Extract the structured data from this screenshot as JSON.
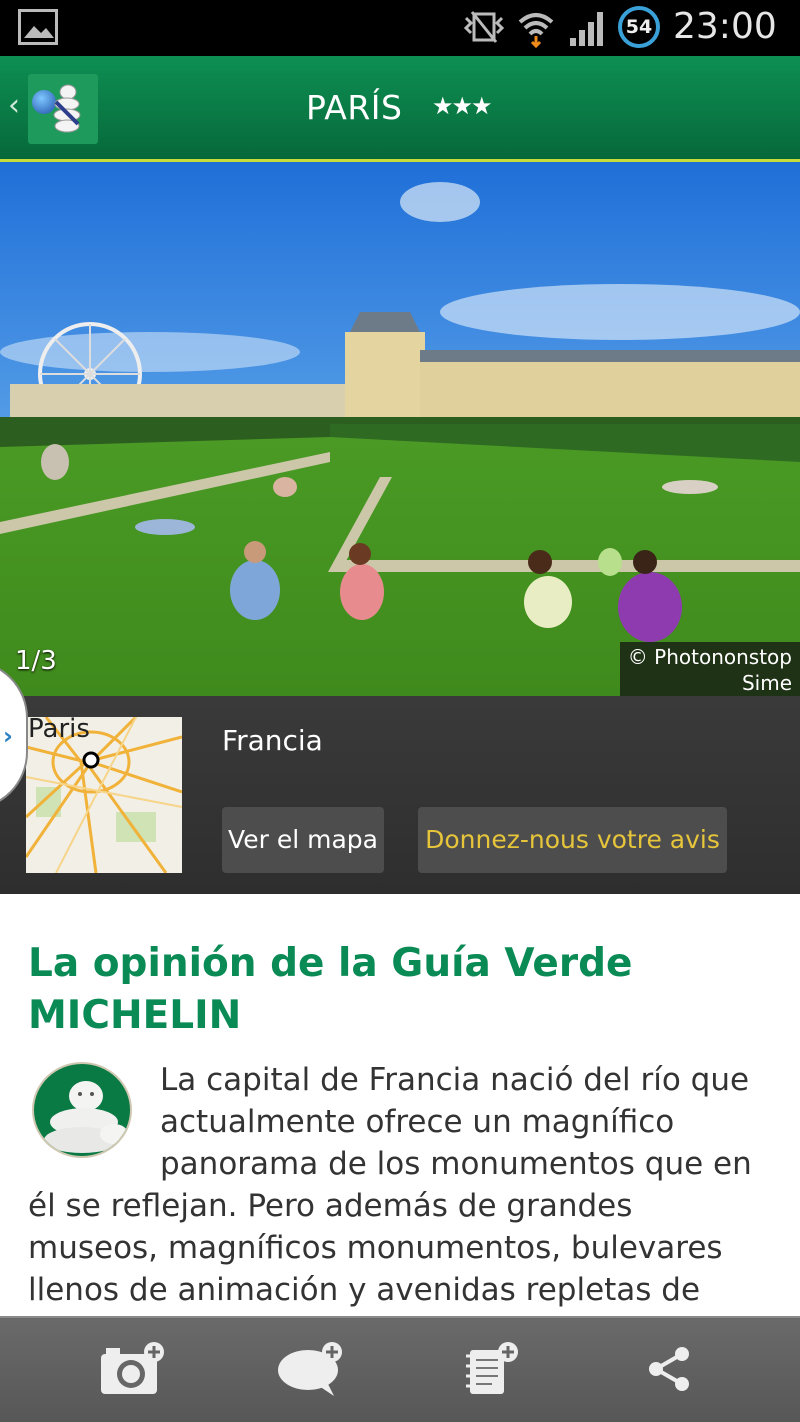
{
  "status_bar": {
    "time": "23:00",
    "battery": "54",
    "icons": [
      "gallery-icon",
      "vibrate-icon",
      "wifi-icon",
      "signal-icon"
    ]
  },
  "header": {
    "back_glyph": "‹",
    "title": "PARÍS",
    "stars": "★★★",
    "logo_icon": "michelin-bibendum-logo"
  },
  "photo": {
    "counter": "1/3",
    "credit_line1": "© Photononstop",
    "credit_line2": "Sime"
  },
  "info": {
    "map_label": "Paris",
    "country": "Francia",
    "map_button": "Ver el mapa",
    "feedback_button": "Donnez-nous votre avis"
  },
  "content": {
    "heading_line1": "La opinión de la Guía Verde",
    "heading_line2": "MICHELIN",
    "paragraph_lines": [
      "La capital de Francia nació del río que",
      "actualmente ofrece un magnífico",
      "panorama de los monumentos que en",
      "él se reflejan. Pero además de grandes",
      "museos, magníficos monumentos, bulevares",
      "llenos de animación y avenidas repletas de"
    ]
  },
  "bottom_bar": {
    "icons": [
      "add-photo-icon",
      "add-comment-icon",
      "add-note-icon",
      "share-icon"
    ]
  },
  "colors": {
    "header_green": "#0a7a45",
    "accent_line": "#c8dc3a",
    "heading_green": "#0a8a55",
    "feedback_yellow": "#e6c53b"
  }
}
